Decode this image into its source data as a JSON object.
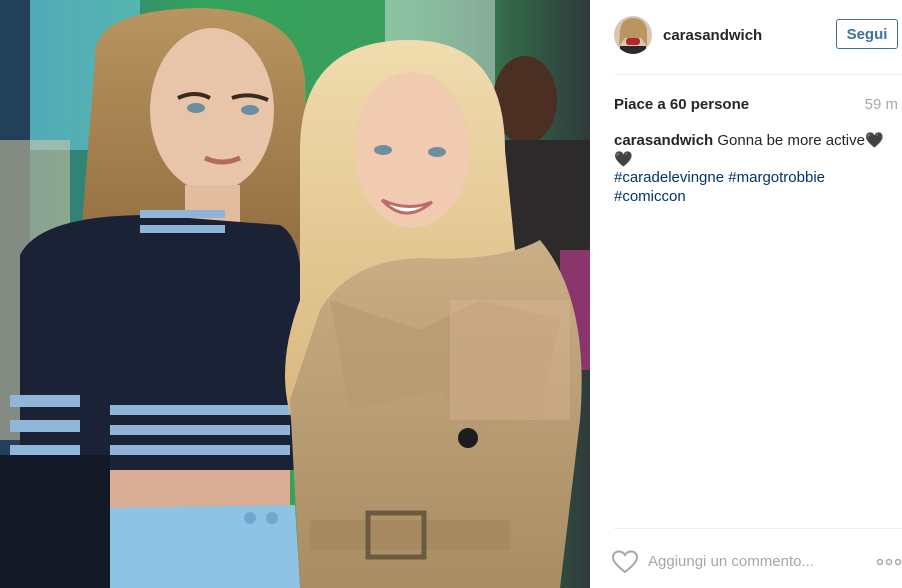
{
  "post": {
    "image": {
      "kind": "photo",
      "colors": {
        "bg_green": "#3a9e5c",
        "stage_lights": "#6fd3e8",
        "blonde_hair": "#e7cf9a",
        "navy_top": "#1b2236",
        "stripe_blue": "#8fb6d8",
        "skirt_blue": "#8ec3e6",
        "trench_beige": "#c2a67d"
      }
    },
    "header": {
      "avatar_icon": "profile-photo",
      "username": "carasandwich",
      "follow_label": "Segui"
    },
    "likes_text": "Piace a 60 persone",
    "timestamp": "59 m",
    "caption": {
      "username": "carasandwich",
      "text": "Gonna be more active",
      "emoji": "🖤🖤",
      "hashtags": [
        "#caradelevingne",
        "#margotrobbie",
        "#comiccon"
      ]
    },
    "footer": {
      "like_icon": "heart-outline",
      "comment_placeholder": "Aggiungi un commento...",
      "more_icon": "ellipsis"
    },
    "accent_color": "#3f729b",
    "hashtag_color": "#003569"
  }
}
